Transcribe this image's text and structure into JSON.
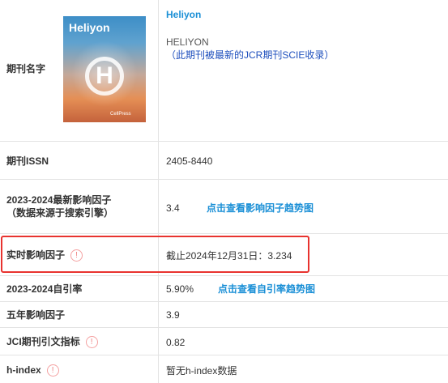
{
  "journal": {
    "name_label": "期刊名字",
    "cover_title": "Heliyon",
    "cover_letter": "H",
    "cover_publisher": "CellPress",
    "title_link": "Heliyon",
    "title_upper": "HELIYON",
    "note": "（此期刊被最新的JCR期刊SCIE收录）"
  },
  "rows": {
    "issn": {
      "label": "期刊ISSN",
      "value": "2405-8440"
    },
    "impact_factor": {
      "label_line1": "2023-2024最新影响因子",
      "label_line2": "（数据来源于搜索引擎）",
      "value": "3.4",
      "link": "点击查看影响因子趋势图"
    },
    "realtime_if": {
      "label": "实时影响因子",
      "value": "截止2024年12月31日：3.234"
    },
    "self_cite": {
      "label": "2023-2024自引率",
      "value": "5.90%",
      "link": "点击查看自引率趋势图"
    },
    "five_year_if": {
      "label": "五年影响因子",
      "value": "3.9"
    },
    "jci": {
      "label": "JCI期刊引文指标",
      "value": "0.82"
    },
    "h_index": {
      "label": "h-index",
      "value": "暂无h-index数据"
    }
  },
  "info_icon_glyph": "!",
  "colors": {
    "link": "#1a8fd6",
    "highlight": "#e8332f",
    "info_icon": "#f08080"
  }
}
